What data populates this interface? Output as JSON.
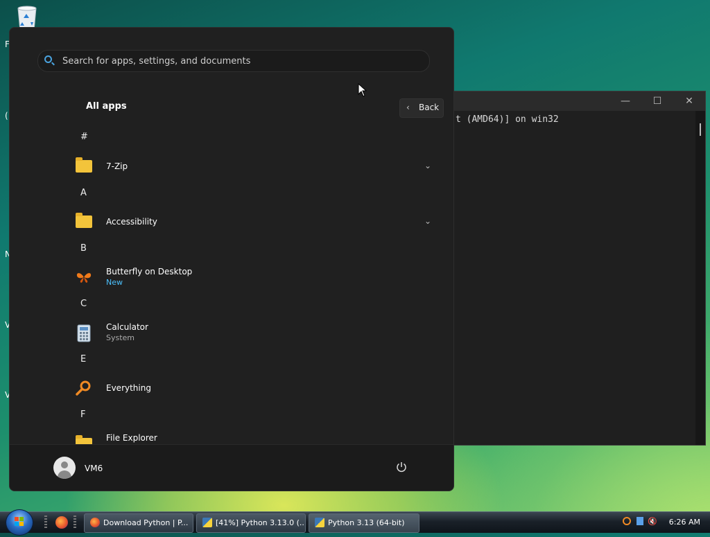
{
  "console": {
    "output_text": "t (AMD64)] on win32",
    "minimize_glyph": "—",
    "maximize_glyph": "☐",
    "close_glyph": "✕"
  },
  "start_menu": {
    "search_placeholder": "Search for apps, settings, and documents",
    "all_apps_title": "All apps",
    "back_label": "Back",
    "back_chevron": "‹",
    "expand_chevron": "⌄",
    "sections": [
      {
        "letter": "#"
      },
      {
        "letter": "A"
      },
      {
        "letter": "B"
      },
      {
        "letter": "C"
      },
      {
        "letter": "E"
      },
      {
        "letter": "F"
      }
    ],
    "apps": [
      {
        "name": "7-Zip",
        "icon": "folder-icon",
        "expandable": true
      },
      {
        "name": "Accessibility",
        "icon": "folder-icon",
        "expandable": true
      },
      {
        "name": "Butterfly on Desktop",
        "subtitle": "New",
        "icon": "butterfly-icon"
      },
      {
        "name": "Calculator",
        "subtitle": "System",
        "icon": "calculator-icon"
      },
      {
        "name": "Everything",
        "icon": "magnifier-icon"
      },
      {
        "name": "File Explorer",
        "icon": "folder-icon"
      }
    ],
    "user_name": "VM6"
  },
  "taskbar": {
    "buttons": [
      {
        "label": "Download Python | P...",
        "icon": "firefox-icon"
      },
      {
        "label": "[41%] Python 3.13.0 (...",
        "icon": "python-installer-icon"
      },
      {
        "label": "Python 3.13 (64-bit)",
        "icon": "python-console-icon",
        "active": true
      }
    ],
    "clock": "6:26 AM",
    "tray_volume_glyph": "🔇"
  },
  "colors": {
    "accent_blue": "#4cc2ff",
    "folder_yellow": "#f3c43b",
    "menu_bg": "#202020"
  }
}
